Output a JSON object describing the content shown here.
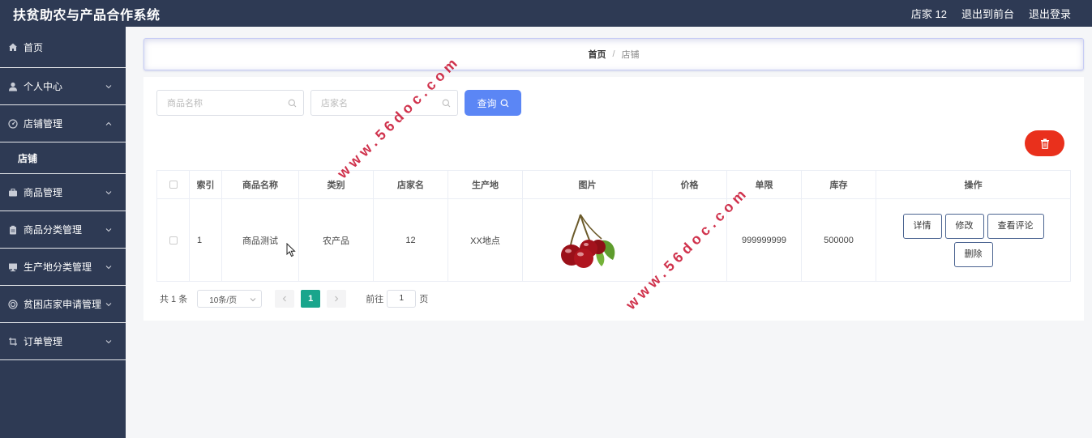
{
  "app": {
    "title": "扶贫助农与产品合作系统"
  },
  "header": {
    "user": "店家 12",
    "to_front": "退出到前台",
    "logout": "退出登录"
  },
  "sidebar": {
    "items": [
      {
        "label": "首页",
        "icon": "home-icon"
      },
      {
        "label": "个人中心",
        "icon": "user-icon"
      },
      {
        "label": "店铺管理",
        "icon": "store-icon",
        "expanded": true,
        "children": [
          {
            "label": "店铺"
          }
        ]
      },
      {
        "label": "商品管理",
        "icon": "briefcase-icon"
      },
      {
        "label": "商品分类管理",
        "icon": "clipboard-icon"
      },
      {
        "label": "生产地分类管理",
        "icon": "monitor-icon"
      },
      {
        "label": "贫困店家申请管理",
        "icon": "circle-icon"
      },
      {
        "label": "订单管理",
        "icon": "crop-icon"
      }
    ]
  },
  "breadcrumb": {
    "home": "首页",
    "sep": "/",
    "current": "店铺"
  },
  "search": {
    "product_placeholder": "商品名称",
    "shop_placeholder": "店家名",
    "query_label": "查询"
  },
  "table": {
    "headers": [
      "索引",
      "商品名称",
      "类别",
      "店家名",
      "生产地",
      "图片",
      "价格",
      "单限",
      "库存",
      "操作"
    ],
    "rows": [
      {
        "index": "1",
        "product": "商品测试",
        "category": "农产品",
        "shop": "12",
        "origin": "XX地点",
        "image": "cherry-image",
        "price": "",
        "limit": "999999999",
        "stock": "500000",
        "actions": [
          "详情",
          "修改",
          "查看评论",
          "删除"
        ]
      }
    ]
  },
  "pager": {
    "total": "共 1 条",
    "page_size": "10条/页",
    "current": "1",
    "goto_prefix": "前往",
    "goto_value": "1",
    "goto_suffix": "页"
  },
  "watermark": "www.56doc.com",
  "colors": {
    "sidebar": "#2e3a54",
    "query": "#5b86f5",
    "delete": "#e9301c",
    "page_active": "#19a58c"
  }
}
